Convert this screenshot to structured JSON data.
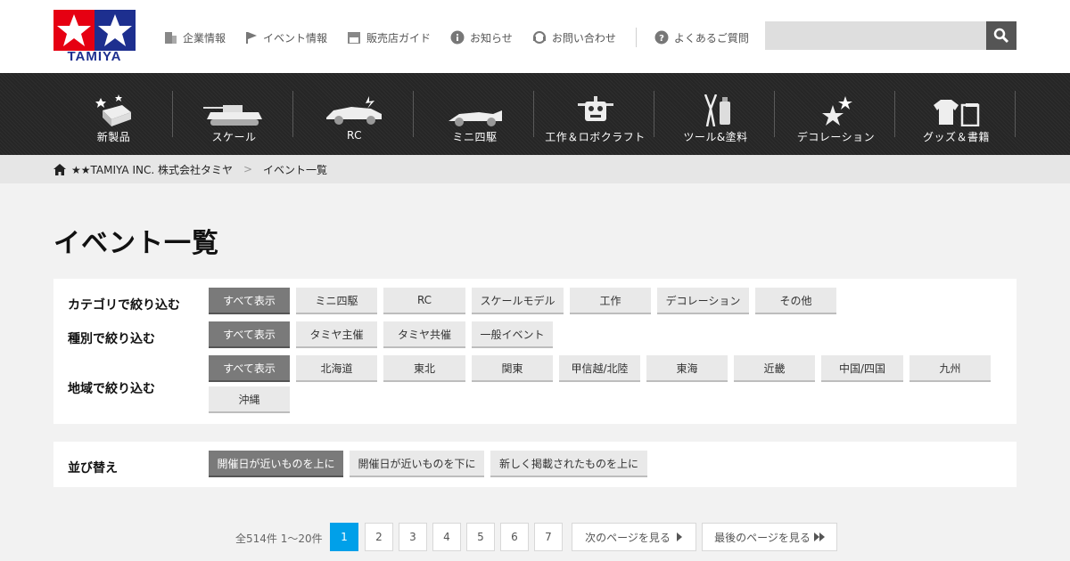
{
  "brand": {
    "logo_text": "TAMIYA",
    "colors": {
      "red": "#e60012",
      "blue": "#1d2f8f",
      "accent": "#00a0e9"
    }
  },
  "topnav": {
    "items": [
      {
        "label": "企業情報",
        "icon": "building-icon"
      },
      {
        "label": "イベント情報",
        "icon": "flag-icon"
      },
      {
        "label": "販売店ガイド",
        "icon": "shop-icon"
      },
      {
        "label": "お知らせ",
        "icon": "info-icon"
      },
      {
        "label": "お問い合わせ",
        "icon": "headset-icon"
      }
    ],
    "faq": {
      "label": "よくあるご質問",
      "icon": "question-icon"
    },
    "search": {
      "placeholder": "",
      "icon": "search-icon"
    }
  },
  "categories": [
    {
      "label": "新製品",
      "icon": "new-product-icon"
    },
    {
      "label": "スケール",
      "icon": "tank-icon"
    },
    {
      "label": "RC",
      "icon": "rc-car-icon"
    },
    {
      "label": "ミニ四駆",
      "icon": "mini4wd-icon"
    },
    {
      "label": "工作＆ロボクラフト",
      "icon": "robot-icon"
    },
    {
      "label": "ツール&塗料",
      "icon": "tools-icon"
    },
    {
      "label": "デコレーション",
      "icon": "sparkle-icon"
    },
    {
      "label": "グッズ＆書籍",
      "icon": "goods-icon"
    }
  ],
  "breadcrumb": {
    "home": "★★TAMIYA INC. 株式会社タミヤ",
    "separator": ">",
    "current": "イベント一覧"
  },
  "page_title": "イベント一覧",
  "filters": {
    "category": {
      "label": "カテゴリで絞り込む",
      "options": [
        "すべて表示",
        "ミニ四駆",
        "RC",
        "スケールモデル",
        "工作",
        "デコレーション",
        "その他"
      ],
      "selected": 0
    },
    "type": {
      "label": "種別で絞り込む",
      "options": [
        "すべて表示",
        "タミヤ主催",
        "タミヤ共催",
        "一般イベント"
      ],
      "selected": 0
    },
    "region": {
      "label": "地域で絞り込む",
      "options": [
        "すべて表示",
        "北海道",
        "東北",
        "関東",
        "甲信越/北陸",
        "東海",
        "近畿",
        "中国/四国",
        "九州",
        "沖縄"
      ],
      "selected": 0
    }
  },
  "sort": {
    "label": "並び替え",
    "options": [
      "開催日が近いものを上に",
      "開催日が近いものを下に",
      "新しく掲載されたものを上に"
    ],
    "selected": 0
  },
  "pagination": {
    "count": "全514件 1～20件",
    "pages": [
      "1",
      "2",
      "3",
      "4",
      "5",
      "6",
      "7"
    ],
    "current": "1",
    "next": "次のページを見る",
    "last": "最後のページを見る"
  }
}
